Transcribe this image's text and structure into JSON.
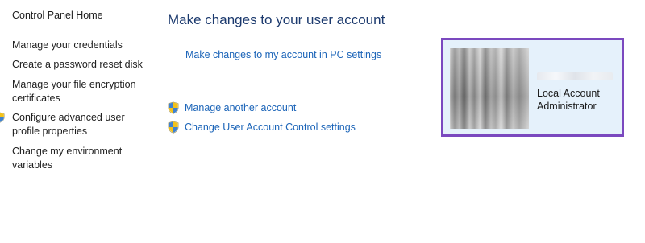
{
  "sidebar": {
    "home": "Control Panel Home",
    "items": [
      {
        "label": "Manage your credentials"
      },
      {
        "label": "Create a password reset disk"
      },
      {
        "label": "Manage your file encryption certificates"
      },
      {
        "label": "Configure advanced user profile properties"
      },
      {
        "label": "Change my environment variables"
      }
    ]
  },
  "main": {
    "title": "Make changes to your user account",
    "pc_settings_link": "Make changes to my account in PC settings",
    "tasks": [
      {
        "label": "Manage another account"
      },
      {
        "label": "Change User Account Control settings"
      }
    ]
  },
  "account": {
    "type": "Local Account",
    "role": "Administrator"
  },
  "colors": {
    "link": "#1b64b8",
    "title": "#1c3a6e",
    "card_background": "#e5f1fb",
    "card_border": "#7b49bf"
  }
}
